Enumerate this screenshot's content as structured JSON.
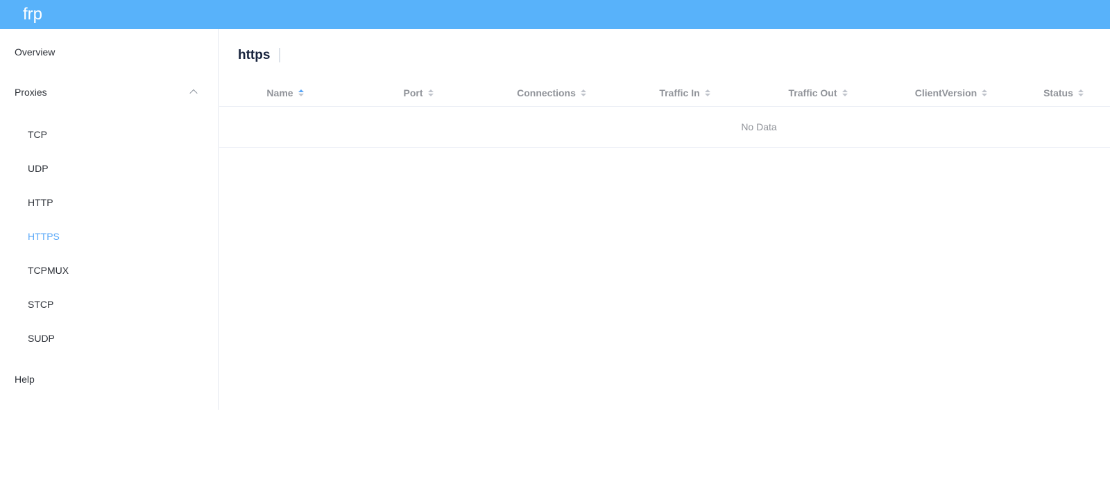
{
  "header": {
    "brand": "frp"
  },
  "sidebar": {
    "items": [
      {
        "label": "Overview"
      },
      {
        "label": "Proxies",
        "expanded": true,
        "children": [
          "TCP",
          "UDP",
          "HTTP",
          "HTTPS",
          "TCPMUX",
          "STCP",
          "SUDP"
        ],
        "active_child": "HTTPS"
      },
      {
        "label": "Help"
      }
    ]
  },
  "main": {
    "title": "https",
    "table": {
      "columns": [
        "Name",
        "Port",
        "Connections",
        "Traffic In",
        "Traffic Out",
        "ClientVersion",
        "Status"
      ],
      "sorted_column": "Name",
      "sort_direction": "ascending",
      "rows": [],
      "empty_text": "No Data"
    }
  },
  "colors": {
    "header_background": "#58b2fa",
    "active_menu_text": "#5ba9f8",
    "sort_active_caret": "#58a6f8",
    "table_header_text": "#909399",
    "table_border": "#ebeef5"
  }
}
